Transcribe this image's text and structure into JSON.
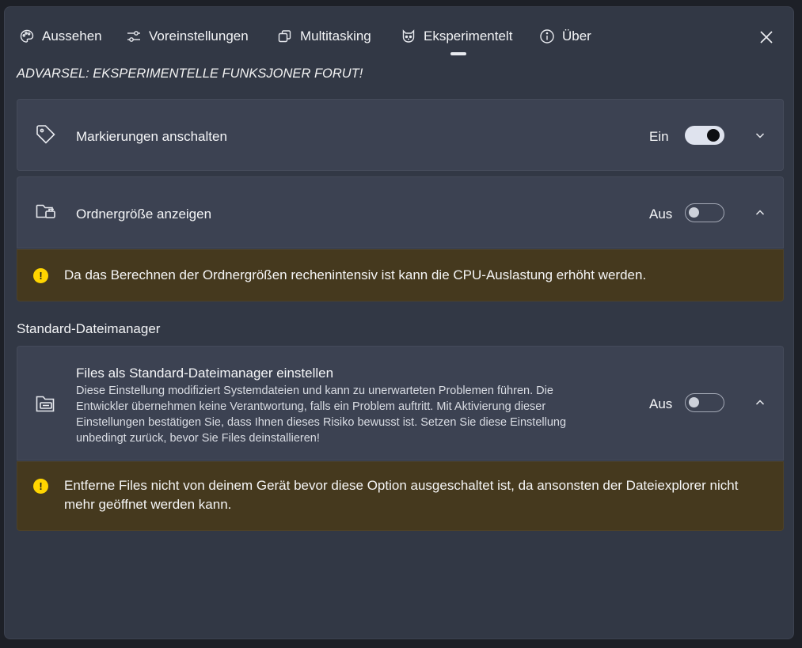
{
  "tabs": [
    {
      "label": "Aussehen",
      "icon": "palette-icon"
    },
    {
      "label": "Voreinstellungen",
      "icon": "sliders-icon"
    },
    {
      "label": "Multitasking",
      "icon": "windows-stack-icon"
    },
    {
      "label": "Eksperimentelt",
      "icon": "cat-icon",
      "selected": true
    },
    {
      "label": "Über",
      "icon": "info-icon"
    }
  ],
  "warning_heading": "ADVARSEL: EKSPERIMENTELLE FUNKSJONER FORUT!",
  "settings": {
    "tags": {
      "title": "Markierungen anschalten",
      "state": "Ein",
      "enabled": true,
      "expanded": false
    },
    "folder_size": {
      "title": "Ordnergröße anzeigen",
      "state": "Aus",
      "enabled": false,
      "expanded": true,
      "info": "Da das Berechnen der Ordnergrößen rechenintensiv ist kann die CPU-Auslastung erhöht werden."
    },
    "section_title": "Standard-Dateimanager",
    "default_manager": {
      "title": "Files als Standard-Dateimanager einstellen",
      "description": "Diese Einstellung modifiziert Systemdateien und kann zu unerwarteten Problemen führen. Die Entwickler übernehmen keine Verantwortung, falls ein Problem auftritt. Mit Aktivierung dieser Einstellungen bestätigen Sie, dass Ihnen dieses Risiko bewusst ist. Setzen Sie diese Einstellung unbedingt zurück, bevor Sie Files deinstallieren!",
      "state": "Aus",
      "enabled": false,
      "expanded": true,
      "info": "Entferne Files nicht von deinem Gerät bevor diese Option ausgeschaltet ist, da ansonsten der Dateiexplorer nicht mehr geöffnet werden kann."
    }
  },
  "warning_glyph": "!",
  "colors": {
    "dialog_bg": "#323845",
    "card_bg": "#3c4252",
    "infobar_bg": "#45391e",
    "warning_icon": "#ffd500"
  }
}
